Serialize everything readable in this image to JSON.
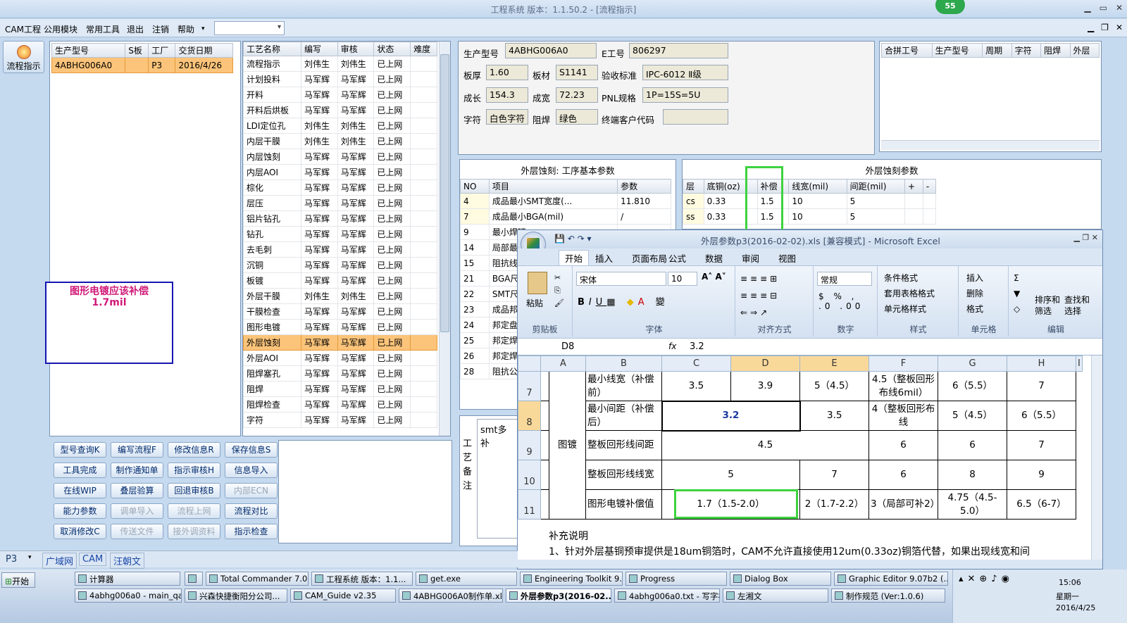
{
  "app": {
    "title": "工程系统  版本：1.1.50.2 - [流程指示]",
    "badge": "55"
  },
  "menu": {
    "items": [
      "CAM工程",
      "公用模块",
      "常用工具",
      "退出",
      "注销",
      "帮助"
    ]
  },
  "left_button": {
    "label": "流程指示"
  },
  "orders": {
    "columns": [
      "生产型号",
      "S板",
      "工厂",
      "交货日期"
    ],
    "rows": [
      [
        "4ABHG006A0",
        "",
        "P3",
        "2016/4/26"
      ]
    ]
  },
  "annotation": {
    "text": "图形电镀应该补偿1.7mil"
  },
  "process": {
    "columns": [
      "工艺名称",
      "编写",
      "审核",
      "状态",
      "难度"
    ],
    "rows": [
      [
        "流程指示",
        "刘伟生",
        "刘伟生",
        "已上网"
      ],
      [
        "计划投料",
        "马军辉",
        "马军辉",
        "已上网"
      ],
      [
        "开料",
        "马军辉",
        "马军辉",
        "已上网"
      ],
      [
        "开料后烘板",
        "马军辉",
        "马军辉",
        "已上网"
      ],
      [
        "LDI定位孔",
        "刘伟生",
        "刘伟生",
        "已上网"
      ],
      [
        "内层干膜",
        "刘伟生",
        "刘伟生",
        "已上网"
      ],
      [
        "内层蚀刻",
        "马军辉",
        "马军辉",
        "已上网"
      ],
      [
        "内层AOI",
        "马军辉",
        "马军辉",
        "已上网"
      ],
      [
        "棕化",
        "马军辉",
        "马军辉",
        "已上网"
      ],
      [
        "层压",
        "马军辉",
        "马军辉",
        "已上网"
      ],
      [
        "铝片钻孔",
        "马军辉",
        "马军辉",
        "已上网"
      ],
      [
        "钻孔",
        "马军辉",
        "马军辉",
        "已上网"
      ],
      [
        "去毛刺",
        "马军辉",
        "马军辉",
        "已上网"
      ],
      [
        "沉铜",
        "马军辉",
        "马军辉",
        "已上网"
      ],
      [
        "板镀",
        "马军辉",
        "马军辉",
        "已上网"
      ],
      [
        "外层干膜",
        "刘伟生",
        "刘伟生",
        "已上网"
      ],
      [
        "干膜检查",
        "马军辉",
        "马军辉",
        "已上网"
      ],
      [
        "图形电镀",
        "马军辉",
        "马军辉",
        "已上网"
      ],
      [
        "外层蚀刻",
        "马军辉",
        "马军辉",
        "已上网"
      ],
      [
        "外层AOI",
        "马军辉",
        "马军辉",
        "已上网"
      ],
      [
        "阻焊塞孔",
        "马军辉",
        "马军辉",
        "已上网"
      ],
      [
        "阻焊",
        "马军辉",
        "马军辉",
        "已上网"
      ],
      [
        "阻焊检查",
        "马军辉",
        "马军辉",
        "已上网"
      ],
      [
        "字符",
        "马军辉",
        "马军辉",
        "已上网"
      ]
    ],
    "selected": 18
  },
  "buttons": [
    [
      "型号查询K",
      "编写流程F",
      "修改信息R",
      "保存信息S"
    ],
    [
      "工具完成",
      "制作通知单",
      "指示审核H",
      "信息导入"
    ],
    [
      "在线WIP",
      "叠层验算",
      "回退审核B",
      "内部ECN"
    ],
    [
      "能力参数",
      "调单导入",
      "流程上网",
      "流程对比"
    ],
    [
      "取消修改C",
      "传送文件",
      "接外调资料",
      "指示检查"
    ]
  ],
  "disabled_buttons": [
    "内部ECN",
    "调单导入",
    "流程上网",
    "传送文件",
    "接外调资料"
  ],
  "info": {
    "model_label": "生产型号",
    "model": "4ABHG006A0",
    "e_label": "E工号",
    "e": "806297",
    "thick_label": "板厚",
    "thick": "1.60",
    "mat_label": "板材",
    "mat": "S1141",
    "std_label": "验收标准",
    "std": "IPC-6012 Ⅱ级",
    "len_label": "成长",
    "len": "154.3",
    "wid_label": "成宽",
    "wid": "72.23",
    "pnl_label": "PNL规格",
    "pnl": "1P=15S=5U",
    "char_label": "字符",
    "char": "白色字符",
    "mask_label": "阻焊",
    "mask": "绿色",
    "cust_label": "终端客户代码",
    "cust": ""
  },
  "merge": {
    "columns": [
      "合拼工号",
      "生产型号",
      "周期",
      "字符",
      "阻焊",
      "外层"
    ]
  },
  "basic": {
    "title": "外层蚀刻: 工序基本参数",
    "columns": [
      "NO",
      "项目",
      "参数"
    ],
    "rows": [
      [
        "4",
        "成品最小SMT宽度(...",
        "11.810"
      ],
      [
        "7",
        "成品最小BGA(mil)",
        "/"
      ],
      [
        "9",
        "最小焊环",
        ""
      ],
      [
        "14",
        "局部最小",
        ""
      ],
      [
        "15",
        "阻抗线宽",
        ""
      ],
      [
        "21",
        "BGA尺寸",
        ""
      ],
      [
        "22",
        "SMT尺寸",
        ""
      ],
      [
        "23",
        "成品邦定",
        ""
      ],
      [
        "24",
        "邦定盘尺",
        ""
      ],
      [
        "25",
        "邦定焊盘",
        ""
      ],
      [
        "26",
        "邦定焊盘",
        ""
      ],
      [
        "28",
        "阻抗公差",
        ""
      ]
    ]
  },
  "etch": {
    "title": "外层蚀刻参数",
    "columns": [
      "层",
      "底铜(oz)",
      "补偿",
      "线宽(mil)",
      "间距(mil)",
      "+",
      "-"
    ],
    "rows": [
      [
        "cs",
        "0.33",
        "1.5",
        "10",
        "5"
      ],
      [
        "ss",
        "0.33",
        "1.5",
        "10",
        "5"
      ]
    ]
  },
  "notes": {
    "label": "工艺备注",
    "text": "smt多补"
  },
  "excel": {
    "title": "外层参数p3(2016-02-02).xls  [兼容模式] - Microsoft Excel",
    "tabs": [
      "开始",
      "插入",
      "页面布局",
      "公式",
      "数据",
      "审阅",
      "视图"
    ],
    "ribbon": {
      "paste": "粘贴",
      "clipboard": "剪贴板",
      "font_name": "宋体",
      "font_size": "10",
      "font": "字体",
      "align": "对齐方式",
      "numfmt": "常规",
      "number": "数字",
      "cond": "条件格式",
      "table": "套用表格格式",
      "cellstyle": "单元格样式",
      "styles": "样式",
      "insert": "插入",
      "delete": "删除",
      "format": "格式",
      "cells": "单元格",
      "sort": "排序和\n筛选",
      "find": "查找和\n选择",
      "edit": "编辑"
    },
    "namebox": "D8",
    "formula": "3.2",
    "cols": [
      "A",
      "B",
      "C",
      "D",
      "E",
      "F",
      "G",
      "H",
      "I"
    ],
    "rows": [
      {
        "n": "7",
        "c": "最小线宽（补偿前）",
        "d": "3.5",
        "e": "3.9",
        "f": "5（4.5）",
        "g": "4.5（整板回形布线6mil）",
        "h": "6（5.5）",
        "i": "7"
      },
      {
        "n": "8",
        "c": "最小间距（补偿后）",
        "de": "3.2",
        "f": "3.5",
        "g": "4（整板回形布线",
        "h": "5（4.5）",
        "i": "6（5.5）"
      },
      {
        "n": "9",
        "c": "整板回形线间距",
        "def": "4.5",
        "g": "6",
        "h": "6",
        "i": "7"
      },
      {
        "n": "10",
        "c": "整板回形线线宽",
        "de": "5",
        "f": "7",
        "g": "6",
        "h": "8",
        "i": "9"
      },
      {
        "n": "11",
        "c": "图形电镀补偿值",
        "de": "1.7（1.5-2.0）",
        "f": "2（1.7-2.2）",
        "g": "3（局部可补2）",
        "h": "4.75（4.5-5.0）",
        "i": "6.5（6-7）"
      }
    ],
    "b_merged": "图镀",
    "supp_title": "补充说明",
    "supp1": "1、针对外层基铜预审提供是18um铜箔时，CAM不允许直接使用12um(0.33oz)铜箔代替，如果出现线宽和间"
  },
  "status": {
    "factory": "P3",
    "tabs": [
      "广域网",
      "CAM",
      "汪朝文"
    ]
  },
  "taskbar": {
    "start": "开始",
    "row1": [
      "计算器",
      "",
      "Total Commander 7.0 ...",
      "工程系统  版本：1.1...",
      "get.exe",
      "Engineering Toolkit 9.0...",
      "Progress",
      "Dialog Box",
      "Graphic Editor 9.07b2 (..."
    ],
    "row2": [
      "4abhg006a0 - main_qa",
      "兴森快捷衡阳分公司...",
      "CAM_Guide v2.35",
      "4ABHG006A0制作单.xl...",
      "外层参数p3(2016-02...",
      "4abhg006a0.txt - 写字板",
      "左湘文",
      "制作规范 (Ver:1.0.6)"
    ],
    "time": "15:06",
    "weekday": "星期一",
    "date": "2016/4/25"
  }
}
